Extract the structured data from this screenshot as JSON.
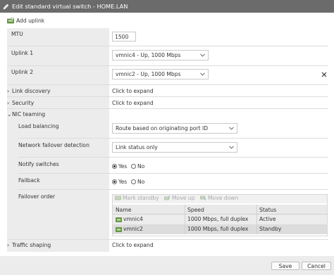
{
  "window": {
    "title": "Edit standard virtual switch - HOME.LAN"
  },
  "toolbar": {
    "add_uplink": "Add uplink"
  },
  "mtu": {
    "label": "MTU",
    "value": "1500"
  },
  "uplinks": [
    {
      "label": "Uplink 1",
      "value": "vmnic4 - Up, 1000 Mbps"
    },
    {
      "label": "Uplink 2",
      "value": "vmnic2 - Up, 1000 Mbps"
    }
  ],
  "sections": {
    "link_discovery": {
      "label": "Link discovery",
      "action": "Click to expand"
    },
    "security": {
      "label": "Security",
      "action": "Click to expand"
    },
    "nic_teaming": {
      "label": "NIC teaming"
    },
    "traffic_shaping": {
      "label": "Traffic shaping",
      "action": "Click to expand"
    }
  },
  "teaming": {
    "load_balancing": {
      "label": "Load balancing",
      "value": "Route based on originating port ID"
    },
    "failover_detection": {
      "label": "Network failover detection",
      "value": "Link status only"
    },
    "notify_switches": {
      "label": "Notify switches",
      "selected": "Yes",
      "options": [
        "Yes",
        "No"
      ]
    },
    "failback": {
      "label": "Failback",
      "selected": "Yes",
      "options": [
        "Yes",
        "No"
      ]
    },
    "failover_order": {
      "label": "Failover order",
      "toolbar": {
        "mark_standby": "Mark standby",
        "move_up": "Move up",
        "move_down": "Move down"
      },
      "columns": [
        "Name",
        "Speed",
        "Status"
      ],
      "rows": [
        {
          "name": "vmnic4",
          "speed": "1000 Mbps, full duplex",
          "status": "Active"
        },
        {
          "name": "vmnic2",
          "speed": "1000 Mbps, full duplex",
          "status": "Standby"
        }
      ]
    }
  },
  "footer": {
    "save": "Save",
    "cancel": "Cancel"
  },
  "colors": {
    "titlebar": "#6b6b6b",
    "panel": "#ececec",
    "nic_icon": "#5a8a3a"
  }
}
